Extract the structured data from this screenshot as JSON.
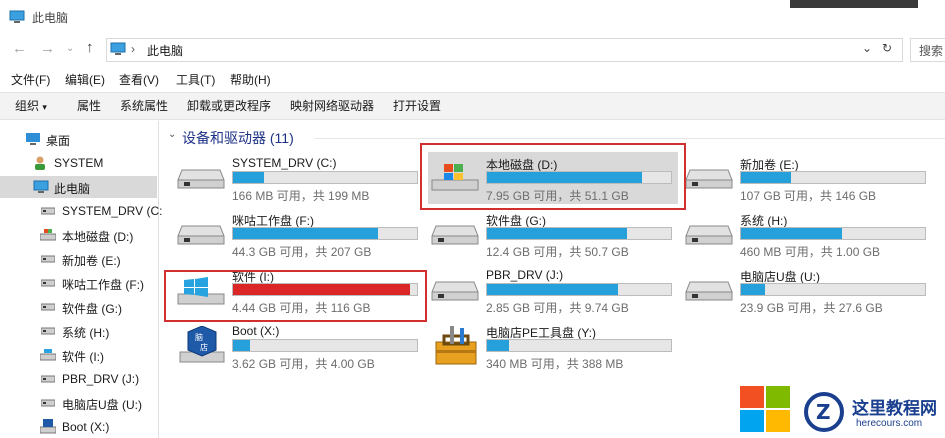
{
  "window": {
    "title": "此电脑"
  },
  "address": {
    "path": "此电脑",
    "search_placeholder": "搜索"
  },
  "menu": [
    "文件(F)",
    "编辑(E)",
    "查看(V)",
    "工具(T)",
    "帮助(H)"
  ],
  "toolbar": [
    "组织",
    "属性",
    "系统属性",
    "卸载或更改程序",
    "映射网络驱动器",
    "打开设置"
  ],
  "nav": {
    "items": [
      {
        "label": "桌面",
        "icon": "desktop-icon"
      },
      {
        "label": "SYSTEM",
        "icon": "user-icon"
      },
      {
        "label": "此电脑",
        "icon": "computer-icon",
        "selected": true
      },
      {
        "label": "SYSTEM_DRV (C:",
        "icon": "drive-icon"
      },
      {
        "label": "本地磁盘 (D:)",
        "icon": "windows-drive-icon"
      },
      {
        "label": "新加卷 (E:)",
        "icon": "drive-icon"
      },
      {
        "label": "咪咕工作盘 (F:)",
        "icon": "drive-icon"
      },
      {
        "label": "软件盘 (G:)",
        "icon": "drive-icon"
      },
      {
        "label": "系统 (H:)",
        "icon": "drive-icon"
      },
      {
        "label": "软件 (I:)",
        "icon": "drive-icon"
      },
      {
        "label": "PBR_DRV (J:)",
        "icon": "drive-icon"
      },
      {
        "label": "电脑店U盘 (U:)",
        "icon": "drive-icon"
      },
      {
        "label": "Boot (X:)",
        "icon": "boot-drive-icon"
      }
    ]
  },
  "group": {
    "header": "设备和驱动器 (11)"
  },
  "drives": [
    {
      "name": "SYSTEM_DRV (C:)",
      "info": "166 MB 可用，共 199 MB",
      "used": 0.17,
      "icon": "drive-icon"
    },
    {
      "name": "本地磁盘 (D:)",
      "info": "7.95 GB 可用，共 51.1 GB",
      "used": 0.84,
      "icon": "windows-drive-icon"
    },
    {
      "name": "新加卷 (E:)",
      "info": "107 GB 可用，共 146 GB",
      "used": 0.27,
      "icon": "drive-icon"
    },
    {
      "name": "咪咕工作盘 (F:)",
      "info": "44.3 GB 可用，共 207 GB",
      "used": 0.79,
      "icon": "drive-icon"
    },
    {
      "name": "软件盘 (G:)",
      "info": "12.4 GB 可用，共 50.7 GB",
      "used": 0.76,
      "icon": "drive-icon"
    },
    {
      "name": "系统 (H:)",
      "info": "460 MB 可用，共 1.00 GB",
      "used": 0.55,
      "icon": "drive-icon"
    },
    {
      "name": "软件 (I:)",
      "info": "4.44 GB 可用，共 116 GB",
      "used": 0.96,
      "icon": "windows-logo-icon",
      "warning": true
    },
    {
      "name": "PBR_DRV (J:)",
      "info": "2.85 GB 可用，共 9.74 GB",
      "used": 0.71,
      "icon": "drive-icon"
    },
    {
      "name": "电脑店U盘 (U:)",
      "info": "23.9 GB 可用，共 27.6 GB",
      "used": 0.13,
      "icon": "drive-icon"
    },
    {
      "name": "Boot (X:)",
      "info": "3.62 GB 可用，共 4.00 GB",
      "used": 0.09,
      "icon": "boot-drive-icon"
    },
    {
      "name": "电脑店PE工具盘 (Y:)",
      "info": "340 MB 可用，共 388 MB",
      "used": 0.12,
      "icon": "toolbox-icon"
    }
  ],
  "watermark": {
    "brand": "这里教程网",
    "url": "herecours.com"
  },
  "colors": {
    "bar": "#26a0da",
    "bar_warning": "#da2626",
    "highlight": "#d23030",
    "group_header": "#1e3287"
  }
}
